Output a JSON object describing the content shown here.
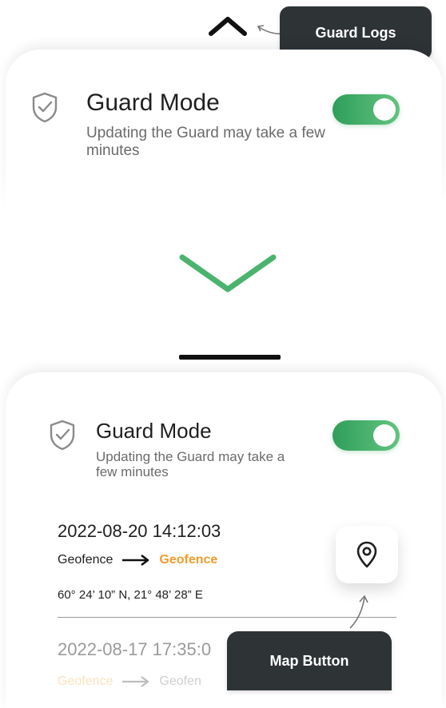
{
  "annotations": {
    "guard_logs": "Guard Logs",
    "map_button": "Map Button"
  },
  "guard_mode": {
    "title": "Guard Mode",
    "subtitle": "Updating the Guard may take a few minutes",
    "enabled": true
  },
  "logs": [
    {
      "timestamp": "2022-08-20 14:12:03",
      "from": "Geofence",
      "to": "Geofence",
      "coordinates": "60° 24’ 10” N, 21° 48’ 28” E"
    },
    {
      "timestamp": "2022-08-17 17:35:0",
      "from": "Geofence",
      "to": "Geofen"
    }
  ],
  "icons": {
    "collapse": "chevron-up-icon",
    "expand": "chevron-down-icon",
    "shield": "shield-check-icon",
    "map": "map-pin-icon",
    "route_arrow": "arrow-right-icon"
  },
  "colors": {
    "accent_green": "#4bb36e",
    "toggle_green_start": "#2f9e5c",
    "destination_orange": "#f39b2a",
    "callout_bg": "#2e3336"
  }
}
